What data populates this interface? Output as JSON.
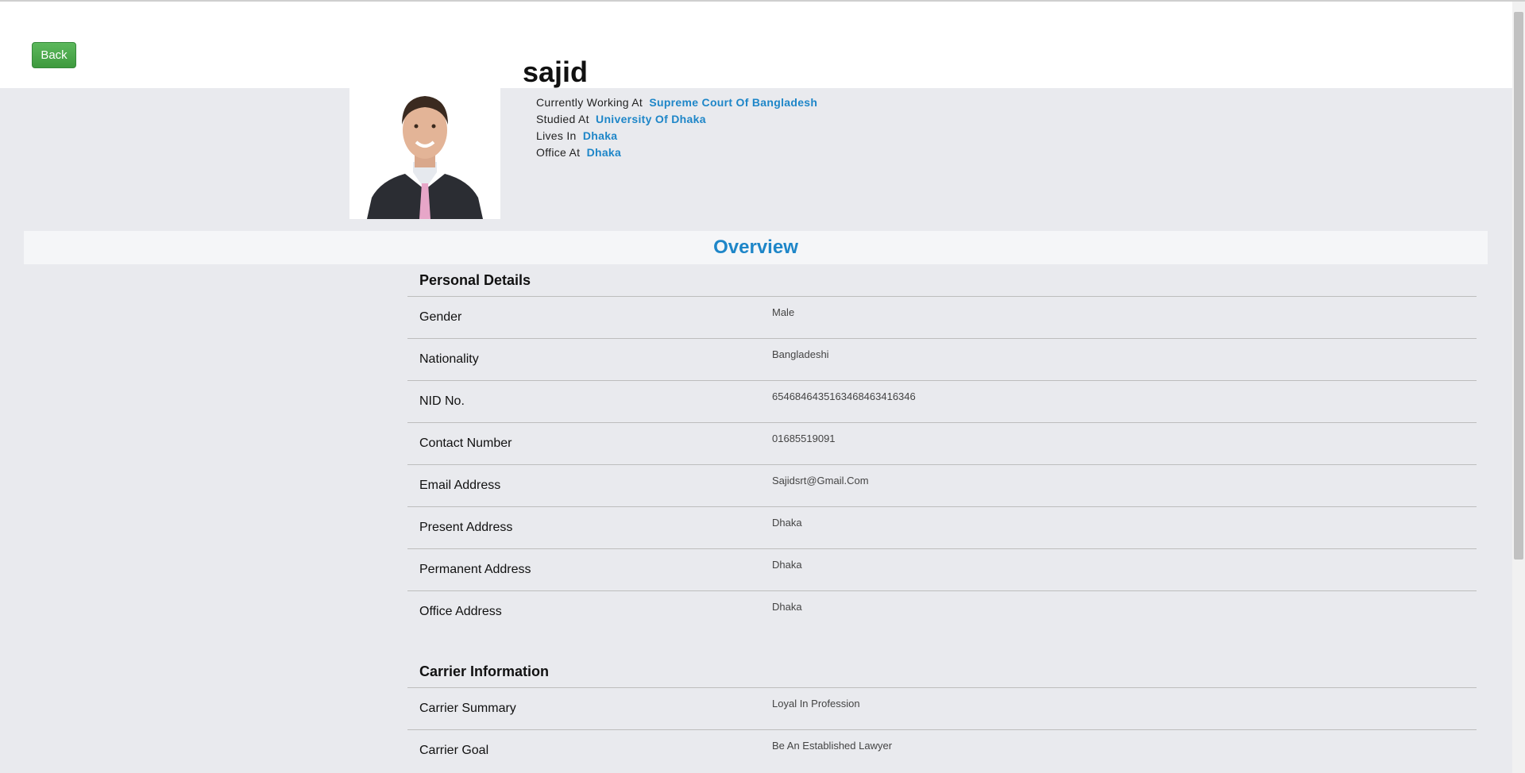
{
  "toolbar": {
    "back_label": "Back"
  },
  "profile": {
    "name": "sajid",
    "info": [
      {
        "label": "Currently Working At",
        "value": "Supreme Court Of Bangladesh"
      },
      {
        "label": "Studied At",
        "value": "University Of Dhaka"
      },
      {
        "label": "Lives In",
        "value": "Dhaka"
      },
      {
        "label": "Office At",
        "value": "Dhaka"
      }
    ]
  },
  "overview": {
    "title": "Overview"
  },
  "personal_details": {
    "title": "Personal Details",
    "rows": [
      {
        "label": "Gender",
        "value": "Male"
      },
      {
        "label": "Nationality",
        "value": "Bangladeshi"
      },
      {
        "label": "NID No.",
        "value": "654684643516346846341634‌6"
      },
      {
        "label": "Contact Number",
        "value": "01685519091"
      },
      {
        "label": "Email Address",
        "value": "Sajidsrt@Gmail.Com"
      },
      {
        "label": "Present Address",
        "value": "Dhaka"
      },
      {
        "label": "Permanent Address",
        "value": "Dhaka"
      },
      {
        "label": "Office Address",
        "value": "Dhaka"
      }
    ]
  },
  "carrier_information": {
    "title": "Carrier Information",
    "rows": [
      {
        "label": "Carrier Summary",
        "value": "Loyal In Profession"
      },
      {
        "label": "Carrier Goal",
        "value": "Be An Established Lawyer"
      }
    ]
  },
  "colors": {
    "accent": "#1e86c8",
    "button_green": "#4cae4c",
    "page_gray": "#e9eaee"
  }
}
